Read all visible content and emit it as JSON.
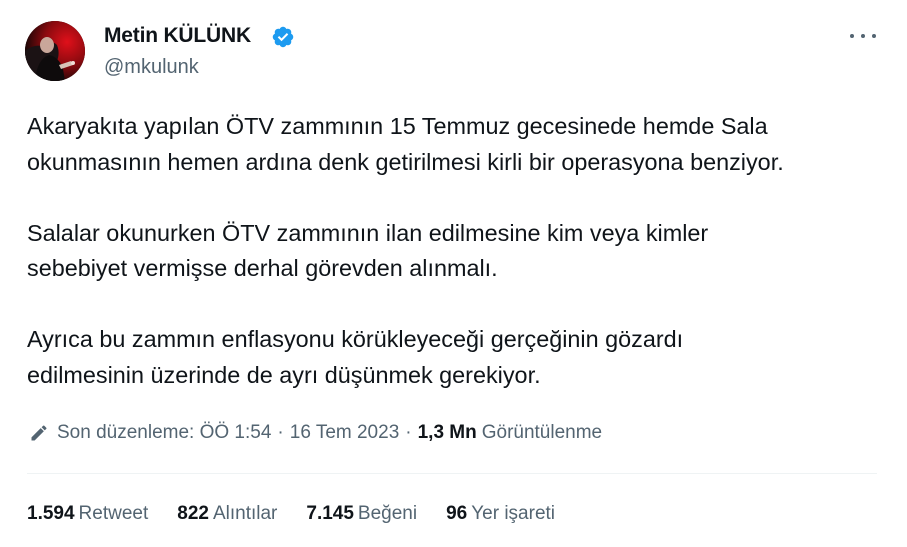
{
  "author": {
    "display_name": "Metin KÜLÜNK",
    "handle": "@mkulunk",
    "verified": true,
    "verified_color": "#1d9bf0"
  },
  "menu_icon": "more-horizontal-icon",
  "body": {
    "paragraph_1": "Akaryakıta yapılan ÖTV zammının 15 Temmuz gecesinede hemde Sala\nokunmasının hemen ardına denk getirilmesi kirli bir operasyona benziyor.",
    "paragraph_2": "Salalar okunurken ÖTV zammının ilan edilmesine kim veya kimler\nsebebiyet vermişse derhal görevden alınmalı.",
    "paragraph_3": "Ayrıca bu zammın enflasyonu körükleyeceği gerçeğinin gözardı\nedilmesinin üzerinde de ayrı düşünmek gerekiyor."
  },
  "meta": {
    "edit_icon": "pencil-icon",
    "edited_label": "Son düzenleme: ÖÖ 1:54",
    "separator": "·",
    "date": "16 Tem 2023",
    "views_count": "1,3 Mn",
    "views_label": "Görüntülenme"
  },
  "stats": {
    "retweets": {
      "count": "1.594",
      "label": "Retweet"
    },
    "quotes": {
      "count": "822",
      "label": "Alıntılar"
    },
    "likes": {
      "count": "7.145",
      "label": "Beğeni"
    },
    "bookmarks": {
      "count": "96",
      "label": "Yer işareti"
    }
  },
  "colors": {
    "text_primary": "#0f1419",
    "text_secondary": "#536471",
    "divider": "#eff3f4"
  }
}
